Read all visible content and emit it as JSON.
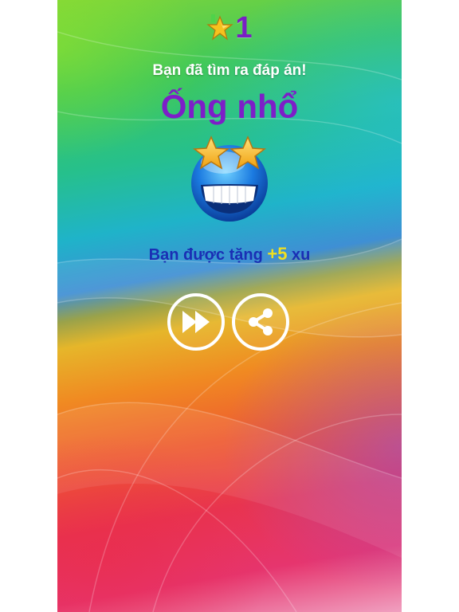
{
  "score": {
    "value": "1",
    "icon": "star-level-icon"
  },
  "result": {
    "found_text": "Bạn đã tìm ra đáp án!",
    "answer": "Ống nhổ"
  },
  "reward": {
    "prefix": "Bạn được tặng",
    "amount": "+5",
    "unit": "xu"
  },
  "buttons": {
    "next_icon": "fast-forward-icon",
    "share_icon": "share-icon"
  },
  "colors": {
    "answer": "#7d1ec8",
    "score": "#7a1fc4",
    "reward_text": "#1a2fb4",
    "reward_amount": "#f0e020"
  }
}
